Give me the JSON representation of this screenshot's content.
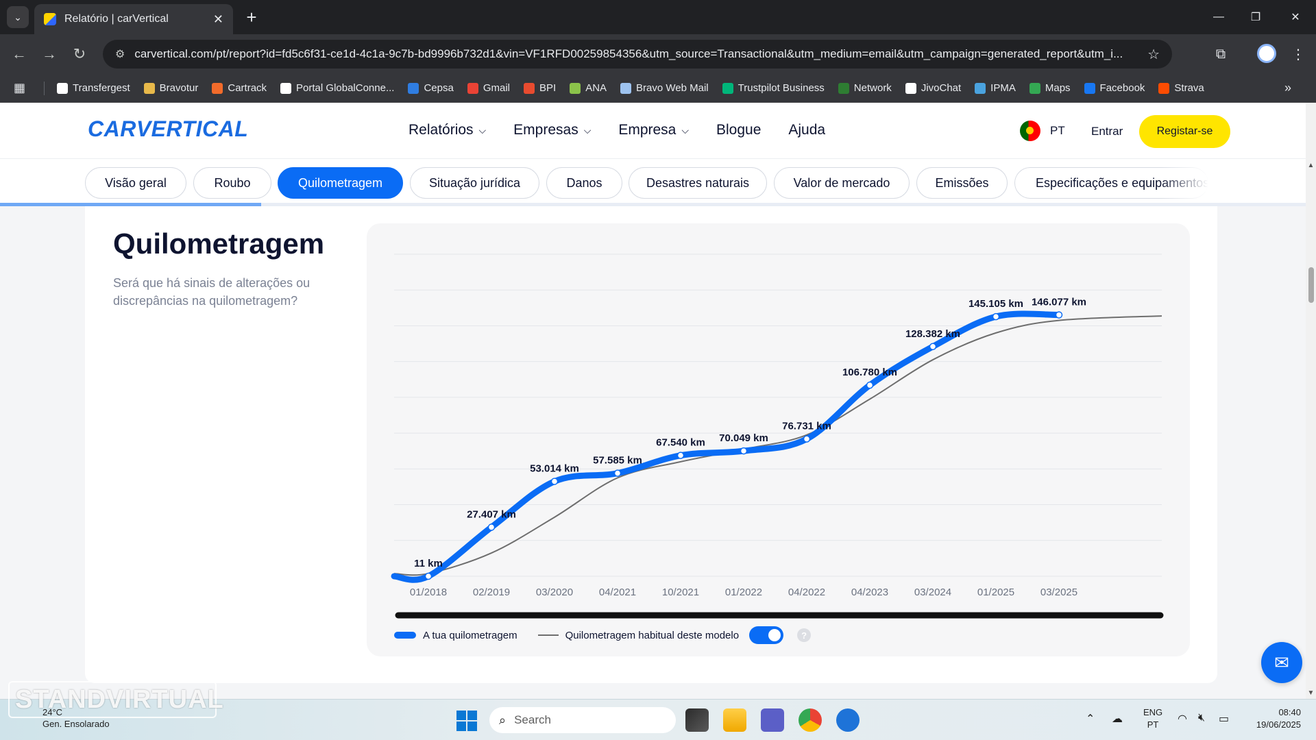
{
  "browser": {
    "tab_title": "Relatório | carVertical",
    "url": "carvertical.com/pt/report?id=fd5c6f31-ce1d-4c1a-9c7b-bd9996b732d1&vin=VF1RFD00259854356&utm_source=Transactional&utm_medium=email&utm_campaign=generated_report&utm_i...",
    "bookmarks": [
      {
        "label": "Transfergest",
        "icon": "transfergest-icon",
        "color": "#ffffff"
      },
      {
        "label": "Bravotur",
        "icon": "bravotur-icon",
        "color": "#e8b94a"
      },
      {
        "label": "Cartrack",
        "icon": "cartrack-icon",
        "color": "#f26b2b"
      },
      {
        "label": "Portal GlobalConne...",
        "icon": "globalconnect-icon",
        "color": "#ffffff"
      },
      {
        "label": "Cepsa",
        "icon": "cepsa-icon",
        "color": "#2f7de1"
      },
      {
        "label": "Gmail",
        "icon": "gmail-icon",
        "color": "#ea4335"
      },
      {
        "label": "BPI",
        "icon": "bpi-icon",
        "color": "#e84b2f"
      },
      {
        "label": "ANA",
        "icon": "ana-icon",
        "color": "#8bc34a"
      },
      {
        "label": "Bravo Web Mail",
        "icon": "mail-icon",
        "color": "#9ec3ef"
      },
      {
        "label": "Trustpilot Business",
        "icon": "trustpilot-icon",
        "color": "#00b67a"
      },
      {
        "label": "Network",
        "icon": "network-icon",
        "color": "#2e7d32"
      },
      {
        "label": "JivoChat",
        "icon": "jivochat-icon",
        "color": "#ffffff"
      },
      {
        "label": "IPMA",
        "icon": "ipma-icon",
        "color": "#4aa3df"
      },
      {
        "label": "Maps",
        "icon": "maps-icon",
        "color": "#34a853"
      },
      {
        "label": "Facebook",
        "icon": "facebook-icon",
        "color": "#1877f2"
      },
      {
        "label": "Strava",
        "icon": "strava-icon",
        "color": "#fc4c02"
      }
    ]
  },
  "site": {
    "logo": "CARVERTICAL",
    "nav": [
      "Relatórios",
      "Empresas",
      "Empresa",
      "Blogue",
      "Ajuda"
    ],
    "lang": "PT",
    "login": "Entrar",
    "register": "Registar-se"
  },
  "sections": [
    {
      "label": "Visão geral",
      "active": false
    },
    {
      "label": "Roubo",
      "active": false
    },
    {
      "label": "Quilometragem",
      "active": true
    },
    {
      "label": "Situação jurídica",
      "active": false
    },
    {
      "label": "Danos",
      "active": false
    },
    {
      "label": "Desastres naturais",
      "active": false
    },
    {
      "label": "Valor de mercado",
      "active": false
    },
    {
      "label": "Emissões",
      "active": false
    },
    {
      "label": "Especificações e equipamentos",
      "active": false
    }
  ],
  "reading_progress": 0.2,
  "mileage": {
    "title": "Quilometragem",
    "subtitle": "Será que há sinais de alterações ou discrepâncias na quilometragem?",
    "legend_own": "A tua quilometragem",
    "legend_model": "Quilometragem habitual deste modelo",
    "toggle_on": true,
    "help": "?"
  },
  "chart_data": {
    "type": "line",
    "categories": [
      "01/2018",
      "02/2019",
      "03/2020",
      "04/2021",
      "10/2021",
      "01/2022",
      "04/2022",
      "04/2023",
      "03/2024",
      "01/2025",
      "03/2025"
    ],
    "series": [
      {
        "name": "A tua quilometragem",
        "color": "#0a6cf5",
        "values": [
          11,
          27407,
          53014,
          57585,
          67540,
          70049,
          76731,
          106780,
          128382,
          145105,
          146077
        ],
        "labels": [
          "11 km",
          "27.407 km",
          "53.014 km",
          "57.585 km",
          "67.540 km",
          "70.049 km",
          "76.731 km",
          "106.780 km",
          "128.382 km",
          "145.105 km",
          "146.077 km"
        ]
      },
      {
        "name": "Quilometragem habitual deste modelo",
        "color": "#6e6e6e",
        "values": [
          1500,
          13000,
          33000,
          55000,
          64000,
          71000,
          79000,
          99000,
          121000,
          136000,
          143000
        ]
      }
    ],
    "ylim": [
      0,
      180000
    ],
    "grid": true
  },
  "taskbar": {
    "weather_temp": "24°C",
    "weather_text": "Gen. Ensolarado",
    "search_label": "Search",
    "lang_top": "ENG",
    "lang_bottom": "PT",
    "time": "08:40",
    "date": "19/06/2025"
  },
  "watermark": "STANDVIRTUAL"
}
